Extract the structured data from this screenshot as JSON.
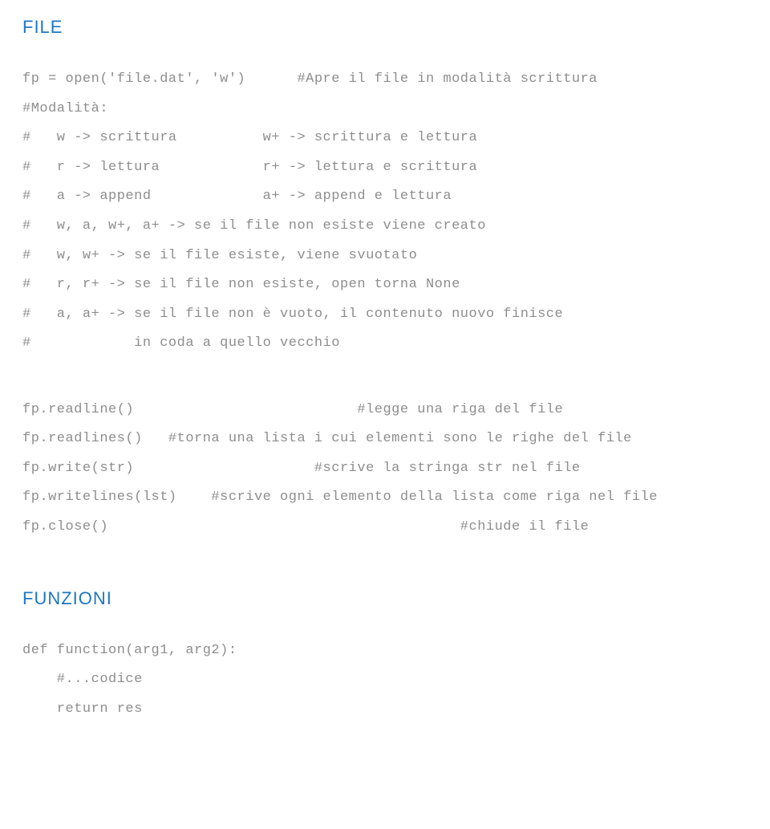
{
  "sections": {
    "file": {
      "heading": "FILE",
      "lines": [
        "fp = open('file.dat', 'w')      #Apre il file in modalità scrittura",
        "#Modalità:",
        "#   w -> scrittura          w+ -> scrittura e lettura",
        "#   r -> lettura            r+ -> lettura e scrittura",
        "#   a -> append             a+ -> append e lettura",
        "#   w, a, w+, a+ -> se il file non esiste viene creato",
        "#   w, w+ -> se il file esiste, viene svuotato",
        "#   r, r+ -> se il file non esiste, open torna None",
        "#   a, a+ -> se il file non è vuoto, il contenuto nuovo finisce",
        "#            in coda a quello vecchio"
      ],
      "methods": [
        "fp.readline()                          #legge una riga del file",
        "fp.readlines()   #torna una lista i cui elementi sono le righe del file",
        "fp.write(str)                     #scrive la stringa str nel file",
        "fp.writelines(lst)    #scrive ogni elemento della lista come riga nel file",
        "fp.close()                                         #chiude il file"
      ]
    },
    "funzioni": {
      "heading": "FUNZIONI",
      "lines": [
        "def function(arg1, arg2):",
        "    #...codice",
        "    return res"
      ]
    }
  }
}
